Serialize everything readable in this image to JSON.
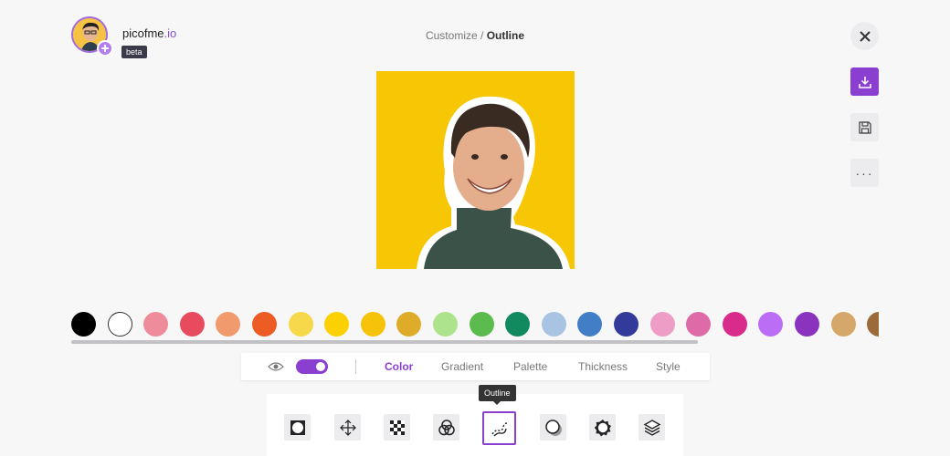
{
  "header": {
    "brand_name": "picofme",
    "brand_tld": ".io",
    "beta_label": "beta",
    "breadcrumb_parent": "Customize",
    "breadcrumb_separator": "/",
    "breadcrumb_current": "Outline"
  },
  "actions": {
    "close_icon": "close-icon",
    "download_icon": "download-icon",
    "save_icon": "save-icon",
    "more_label": "···"
  },
  "swatches": [
    "#000000",
    "#ffffff",
    "#ee8c9c",
    "#e94b5e",
    "#f09a6e",
    "#ec5c24",
    "#f7d84a",
    "#fbd103",
    "#f6c30a",
    "#dfac29",
    "#aee38e",
    "#5cbb4e",
    "#118a60",
    "#a8c4e2",
    "#427ec5",
    "#323b9a",
    "#ee9dc6",
    "#df6aa8",
    "#d82b8c",
    "#bb6ef5",
    "#8933be",
    "#d5a76a",
    "#9b6c3a"
  ],
  "tabs": {
    "visibility_icon": "eye-icon",
    "toggle_on": true,
    "items": [
      "Color",
      "Gradient",
      "Palette",
      "Thickness",
      "Style"
    ],
    "active": "Color"
  },
  "tools": {
    "tooltip": "Outline",
    "items": [
      "frame-icon",
      "move-icon",
      "transparency-icon",
      "color-filter-icon",
      "outline-icon",
      "shadow-icon",
      "badge-icon",
      "layers-icon"
    ],
    "active": "outline-icon"
  },
  "accent_color": "#8a3fd0"
}
